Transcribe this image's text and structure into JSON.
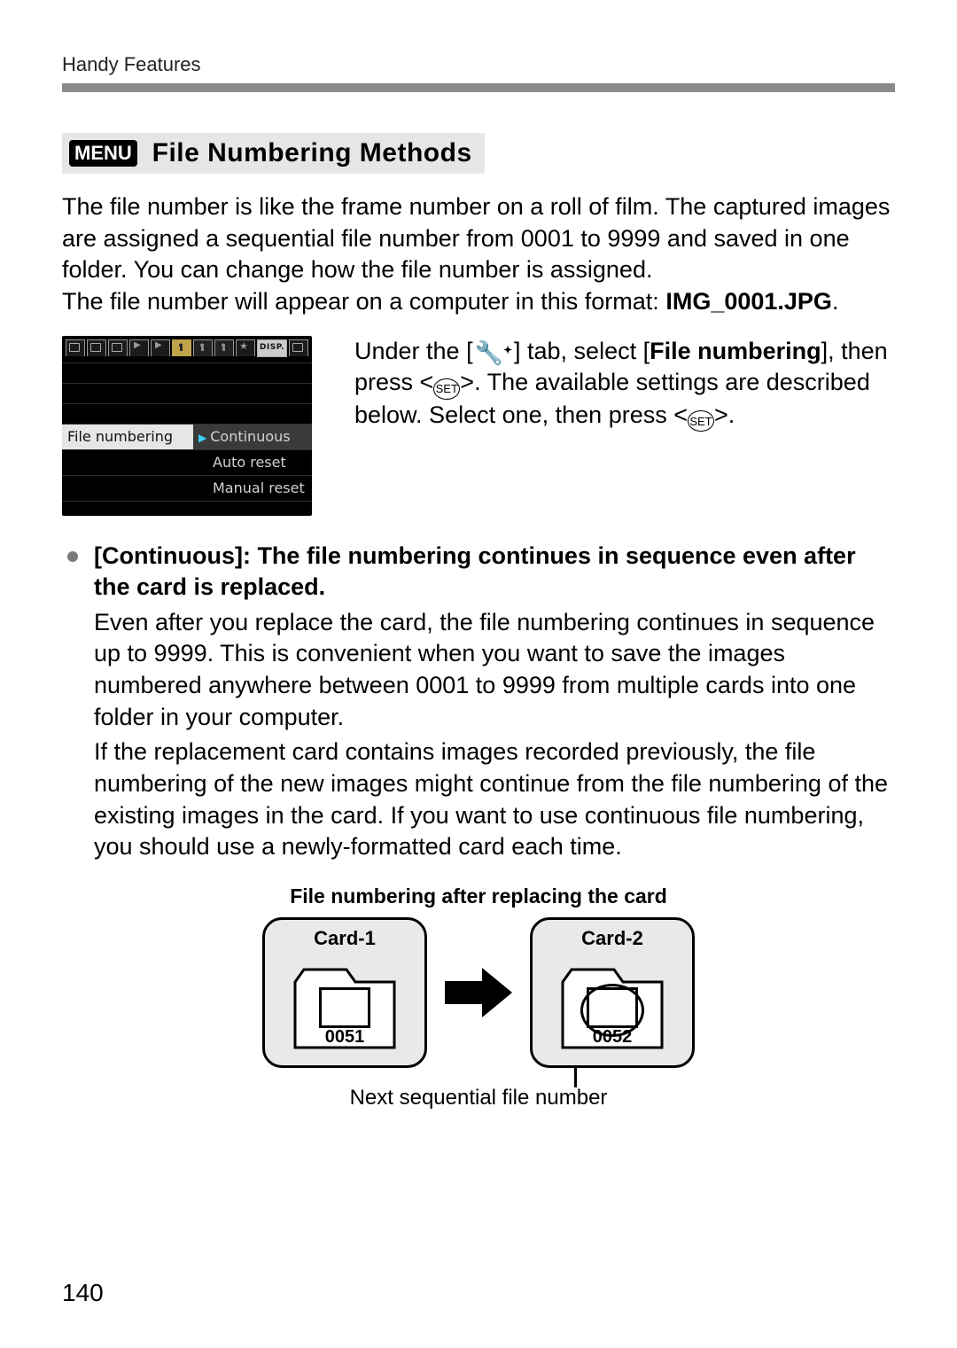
{
  "header": {
    "running": "Handy Features"
  },
  "section": {
    "menu_badge": "MENU",
    "title": "File Numbering Methods"
  },
  "intro": {
    "p1": "The file number is like the frame number on a roll of film. The captured images are assigned a sequential file number from 0001 to 9999 and saved in one folder. You can change how the file number is assigned.",
    "p2_prefix": "The file number will appear on a computer in this format: ",
    "filename": "IMG_0001.JPG",
    "period": "."
  },
  "lcd": {
    "disp_label": "DISP.",
    "row_label": "File numbering",
    "options": [
      "Continuous",
      "Auto reset",
      "Manual reset"
    ]
  },
  "rhs": {
    "t1a": "Under the [",
    "wrench_sup": "✦",
    "t1b": "] tab, select [",
    "bold1": "File numbering",
    "t1c": "], then press <",
    "set": "SET",
    "t1d": ">. The available settings are described below. Select one, then press <",
    "t1e": ">."
  },
  "bullet": {
    "head": "[Continuous]: The file numbering continues in sequence even after the card is replaced.",
    "body1": "Even after you replace the card, the file numbering continues in sequence up to 9999. This is convenient when you want to save the images numbered anywhere between 0001 to 9999 from multiple cards into one folder in your computer.",
    "body2": "If the replacement card contains images recorded previously, the file numbering of the new images might continue from the file numbering of the existing images in the card. If you want to use continuous file numbering, you should use a newly-formatted card each time."
  },
  "diagram": {
    "title": "File numbering after replacing the card",
    "card1": {
      "name": "Card-1",
      "num": "0051"
    },
    "card2": {
      "name": "Card-2",
      "num": "0052"
    },
    "callout": "Next sequential file number"
  },
  "page_number": "140"
}
